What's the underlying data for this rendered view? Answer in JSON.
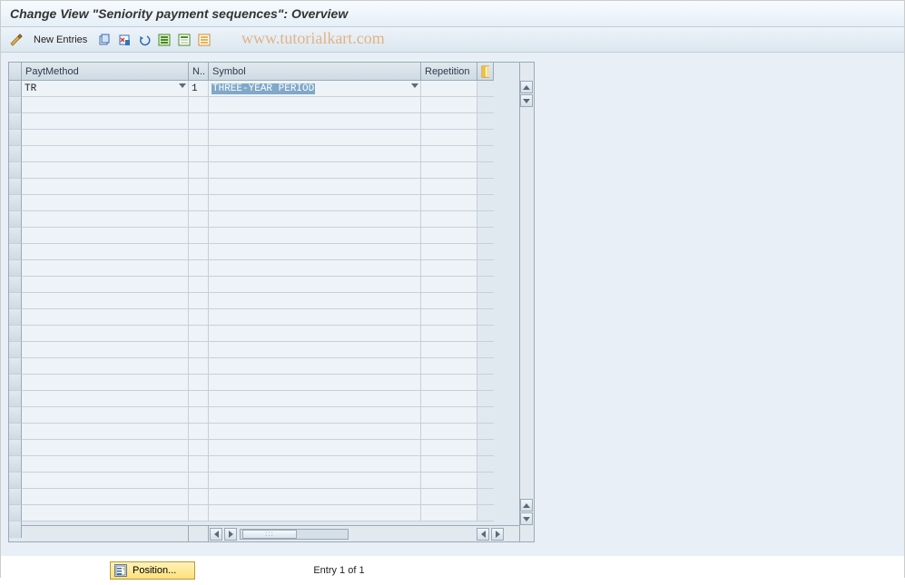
{
  "title": "Change View \"Seniority payment sequences\": Overview",
  "toolbar": {
    "new_entries_label": "New Entries"
  },
  "watermark": "www.tutorialkart.com",
  "grid": {
    "headers": {
      "paytmethod": "PaytMethod",
      "n": "N..",
      "symbol": "Symbol",
      "repetition": "Repetition"
    },
    "rows": [
      {
        "paytmethod": "TR",
        "n": "1",
        "symbol": "THREE-YEAR PERIOD",
        "repetition": ""
      }
    ],
    "empty_row_count": 26
  },
  "footer": {
    "position_label": "Position...",
    "entry_text": "Entry 1 of 1"
  }
}
